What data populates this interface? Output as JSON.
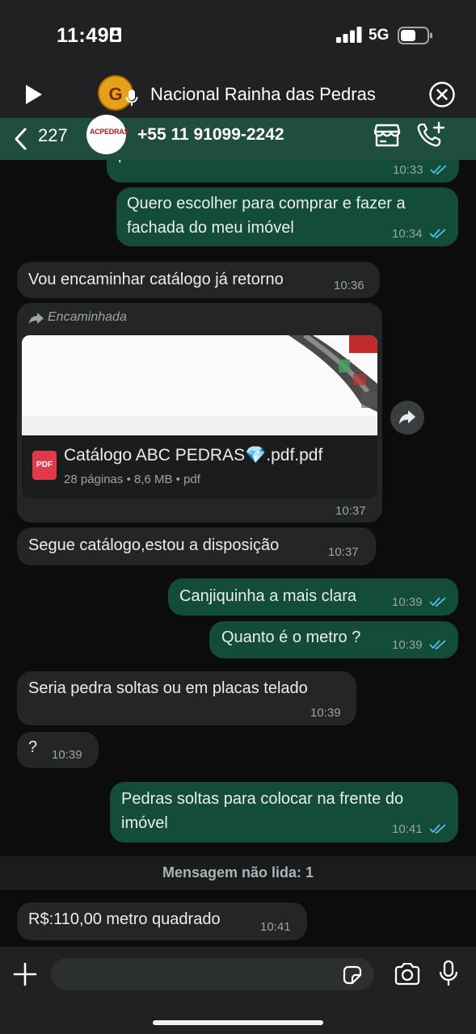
{
  "status_bar": {
    "time": "11:49",
    "network": "5G"
  },
  "call_banner": {
    "title": "Nacional Rainha das Pedras",
    "avatar_letter": "G"
  },
  "chat_header": {
    "back_count": "227",
    "contact_name": "+55 11 91099-2242",
    "avatar_logo": "ACPEDRAS"
  },
  "messages": [
    {
      "dir": "out",
      "text": "pedras",
      "time": "10:33"
    },
    {
      "dir": "out",
      "text": "Quero escolher para comprar e fazer a fachada do meu imóvel",
      "time": "10:34"
    },
    {
      "dir": "in",
      "text": "Vou encaminhar catálogo já retorno",
      "time": "10:36"
    },
    {
      "dir": "in",
      "forwarded": "Encaminhada",
      "doc_name": "Catálogo ABC PEDRAS💎.pdf.pdf",
      "doc_meta": "28 páginas • 8,6 MB • pdf",
      "doc_type": "PDF",
      "time": "10:37"
    },
    {
      "dir": "in",
      "text": "Segue catálogo,estou a disposição",
      "time": "10:37"
    },
    {
      "dir": "out",
      "text": "Canjiquinha a mais clara",
      "time": "10:39"
    },
    {
      "dir": "out",
      "text": "Quanto é o metro ?",
      "time": "10:39"
    },
    {
      "dir": "in",
      "text": "Seria pedra soltas ou em placas telado",
      "time": "10:39"
    },
    {
      "dir": "in",
      "text": "?",
      "time": "10:39"
    },
    {
      "dir": "out",
      "text": "Pedras soltas para colocar na frente do imóvel",
      "time": "10:41"
    },
    {
      "dir": "in",
      "text": "R$:110,00 metro quadrado",
      "time": "10:41"
    }
  ],
  "unread_divider": "Mensagem não lida: 1",
  "input": {
    "value": "",
    "placeholder": ""
  },
  "colors": {
    "outgoing_bubble": "#144d37",
    "incoming_bubble": "#242626",
    "header": "#1f4d3f",
    "read_tick": "#53bdeb"
  }
}
